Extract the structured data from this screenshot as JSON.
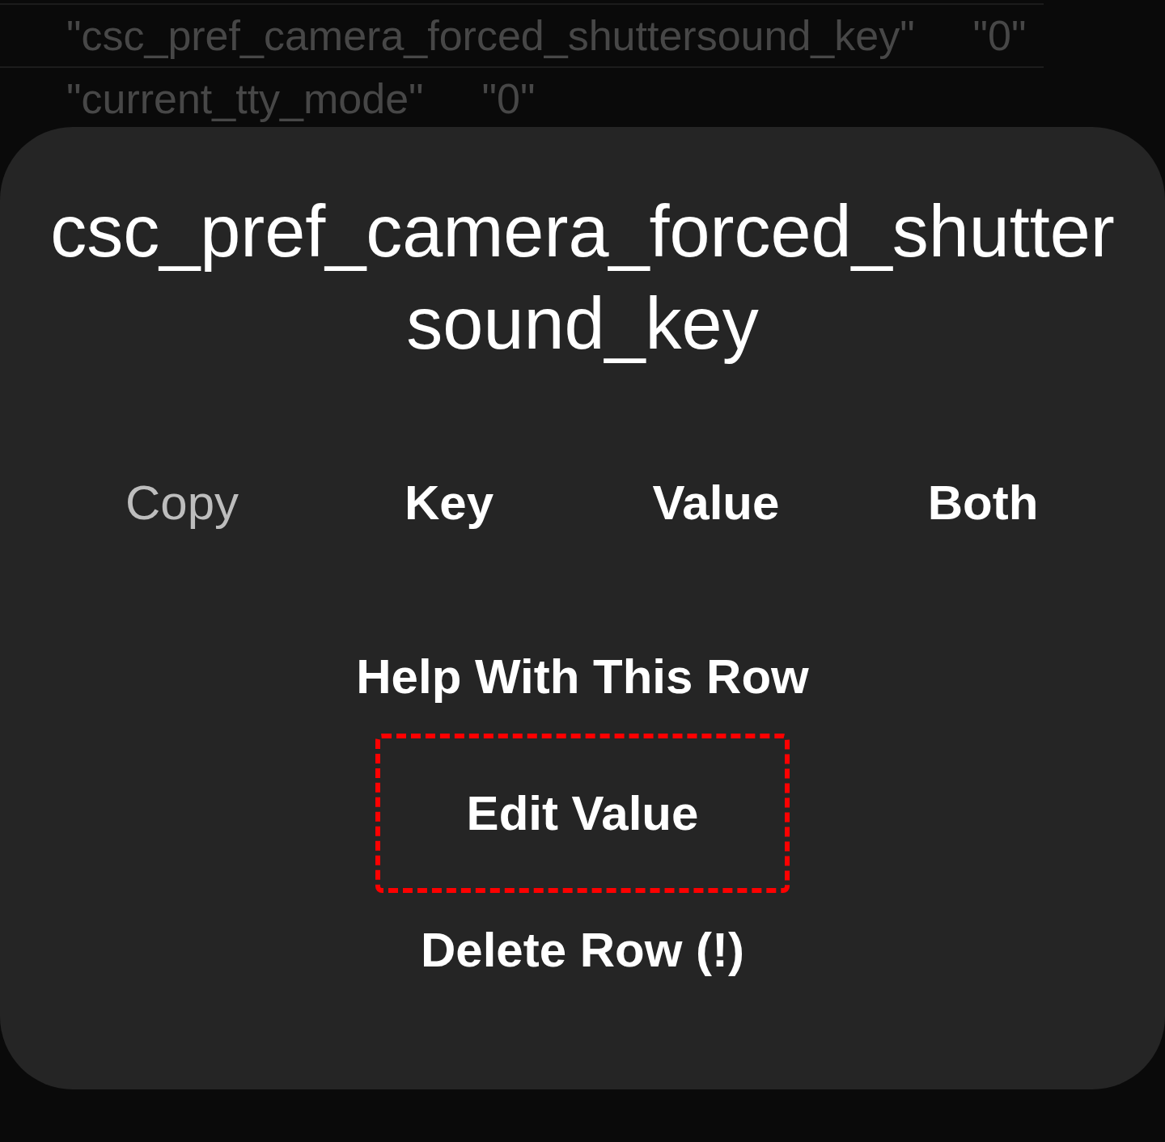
{
  "background_rows": [
    {
      "key": "\"csc_pref_camera_forced_shuttersound_key\"",
      "value": "\"0\""
    },
    {
      "key": "\"current_tty_mode\"",
      "value": "\"0\""
    }
  ],
  "dialog": {
    "title": "csc_pref_camera_forced_shuttersound_key",
    "copy": {
      "label": "Copy",
      "options": [
        "Key",
        "Value",
        "Both"
      ]
    },
    "actions": [
      {
        "label": "Help With This Row",
        "highlighted": false
      },
      {
        "label": "Edit Value",
        "highlighted": true
      },
      {
        "label": "Delete Row (!)",
        "highlighted": false
      }
    ]
  }
}
